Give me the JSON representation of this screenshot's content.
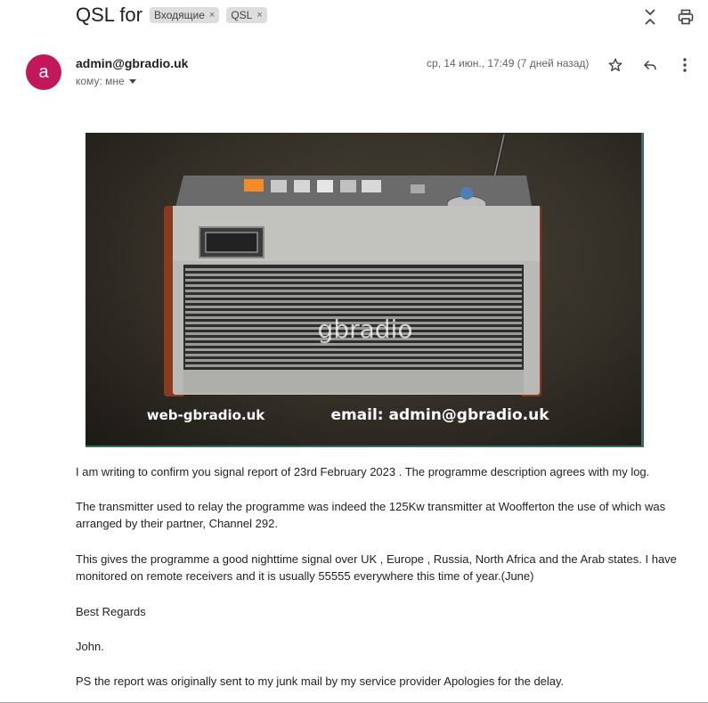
{
  "header": {
    "subject": "QSL for",
    "labels": [
      {
        "name": "Входящие",
        "remove": "×"
      },
      {
        "name": "QSL",
        "remove": "×"
      }
    ],
    "icons": [
      "collapse-icon",
      "print-icon"
    ]
  },
  "message": {
    "avatar_letter": "a",
    "sender": "admin@gbradio.uk",
    "to_label": "кому: мне",
    "date": "ср, 14 июн., 17:49 (7 дней назад)",
    "actions": [
      "star-icon",
      "reply-icon",
      "more-vert-icon"
    ],
    "colors": {
      "avatar": "#c2185b"
    }
  },
  "image": {
    "watermark": "gbradio",
    "website": "web-gbradio.uk",
    "email": "email: admin@gbradio.uk"
  },
  "body": {
    "p1": "I am writing to confirm you signal report of 23rd February 2023 . The programme description agrees with my log.",
    "p2": "The transmitter used to relay the programme was indeed the 125Kw transmitter at Woofferton the use of which was arranged by their partner, Channel 292.",
    "p3": "This gives the programme a good nighttime signal over  UK , Europe , Russia, North Africa and  the Arab states. I have monitored on remote receivers and it is usually 55555 everywhere this time of year.(June)",
    "p4": "Best Regards",
    "p5": "John.",
    "p6": "PS the report was originally sent to my junk mail by my service provider Apologies for the delay."
  }
}
